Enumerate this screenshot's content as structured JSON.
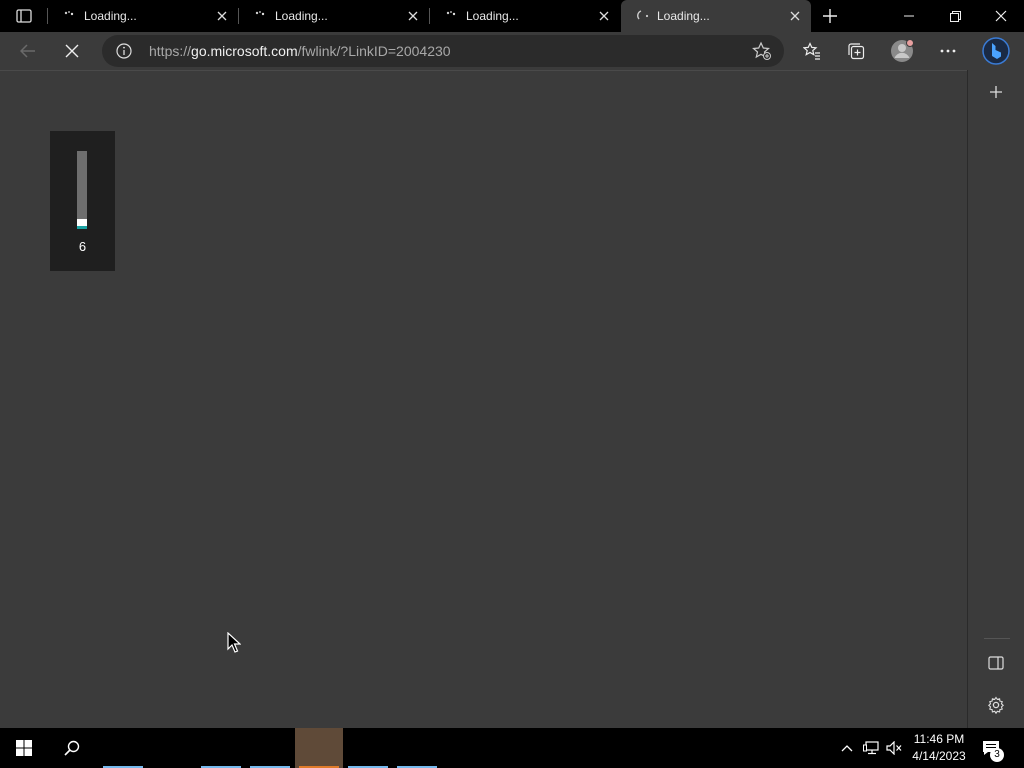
{
  "browser": {
    "tabs": [
      {
        "title": "Loading..."
      },
      {
        "title": "Loading..."
      },
      {
        "title": "Loading..."
      },
      {
        "title": "Loading...",
        "active": true
      }
    ],
    "address": {
      "protocol": "https://",
      "host": "go.microsoft.com",
      "path": "/fwlink/?LinkID=2004230"
    }
  },
  "volume_osd": {
    "level_label": "6",
    "level": 0.06
  },
  "taskbar": {
    "clock_time": "11:46 PM",
    "clock_date": "4/14/2023",
    "notification_count": "3"
  },
  "colors": {
    "page_bg": "#3b3b3b",
    "tabstrip_bg": "#000000",
    "taskbar_active": "#e07b2a",
    "taskbar_indicator": "#76b9ed"
  }
}
